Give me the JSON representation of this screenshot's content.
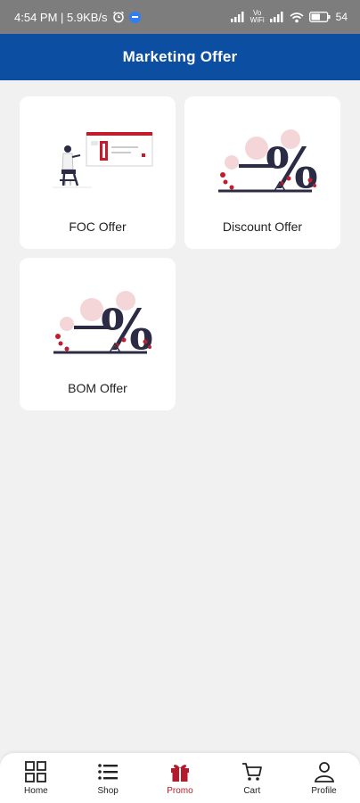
{
  "status_bar": {
    "time_speed": "4:54 PM | 5.9KB/s",
    "volte": "Vo\nWiFi",
    "battery": "54"
  },
  "header": {
    "title": "Marketing Offer"
  },
  "offers": [
    {
      "label": "FOC Offer",
      "icon": "person-board-illustration"
    },
    {
      "label": "Discount Offer",
      "icon": "percent-illustration"
    },
    {
      "label": "BOM Offer",
      "icon": "percent-illustration"
    }
  ],
  "nav": {
    "items": [
      {
        "label": "Home",
        "icon": "grid-icon"
      },
      {
        "label": "Shop",
        "icon": "list-icon"
      },
      {
        "label": "Promo",
        "icon": "gift-icon",
        "active": true
      },
      {
        "label": "Cart",
        "icon": "cart-icon"
      },
      {
        "label": "Profile",
        "icon": "person-icon"
      }
    ]
  },
  "colors": {
    "header": "#0b4ea2",
    "active": "#b31b2c",
    "illustration_dark": "#2b2b45",
    "illustration_red": "#c21d2d",
    "illustration_pink": "#f4d6d9"
  }
}
